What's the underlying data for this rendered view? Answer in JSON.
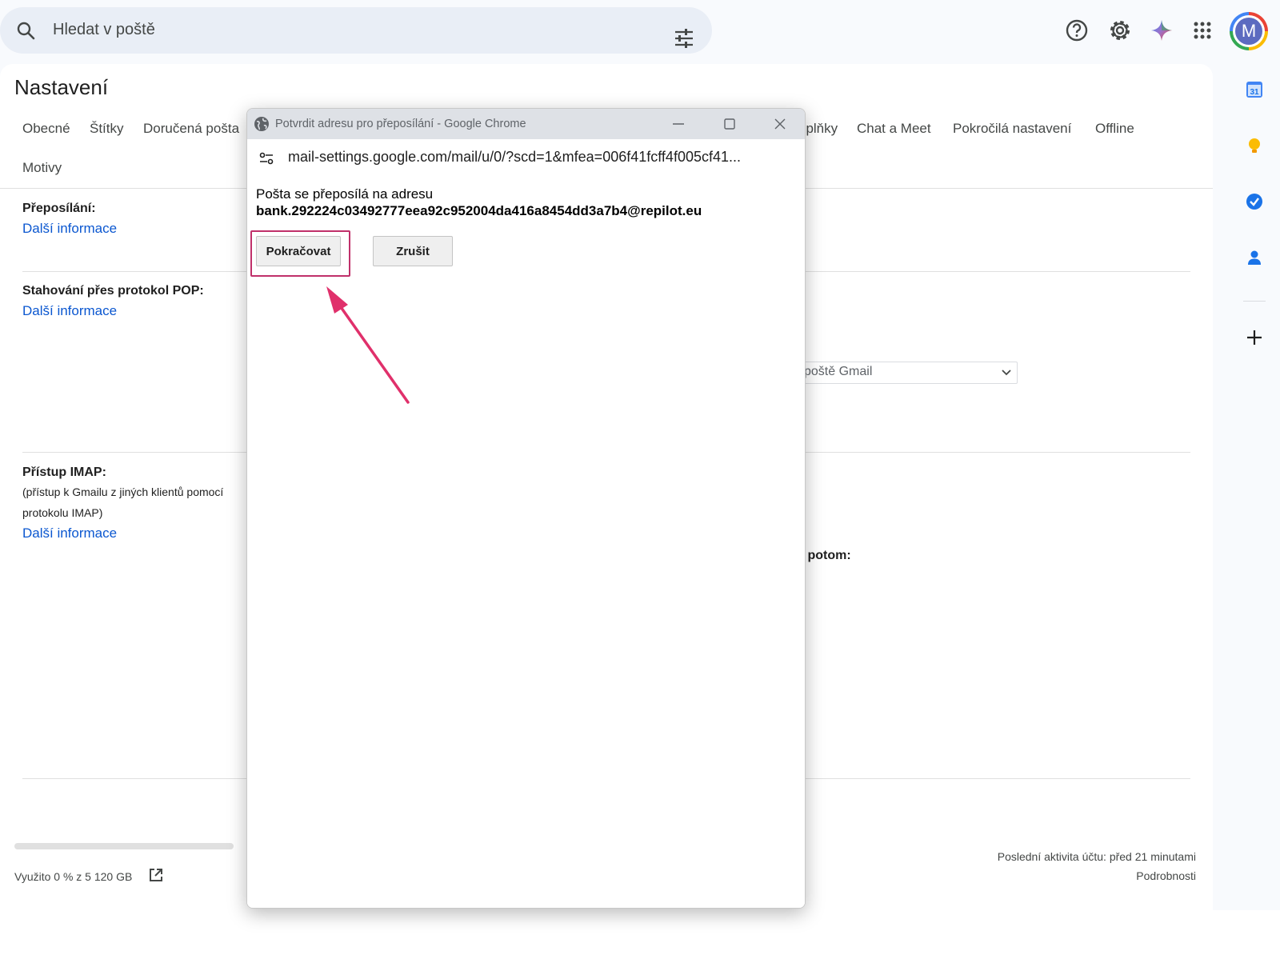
{
  "search": {
    "placeholder": "Hledat v poště"
  },
  "avatar": {
    "initial": "M"
  },
  "page_title": "Nastavení",
  "tabs": [
    "Obecné",
    "Štítky",
    "Doručená pošta",
    "oplňky",
    "Chat a Meet",
    "Pokročilá nastavení",
    "Offline",
    "Motivy"
  ],
  "sections": {
    "forwarding": {
      "label": "Přeposílání:",
      "link": "Další informace"
    },
    "pop": {
      "label": "Stahování přes protokol POP:",
      "link": "Další informace",
      "select_value": "poště Gmail"
    },
    "imap": {
      "label": "Přístup IMAP:",
      "desc1": "(přístup k Gmailu z jiných klientů pomocí",
      "desc2": "protokolu IMAP)",
      "link": "Další informace",
      "partial_text": "P, potom:"
    }
  },
  "side_panel": {
    "calendar_day": "31"
  },
  "footer": {
    "storage": "Využito 0 % z 5 120 GB",
    "storage_fraction": 0,
    "last_activity": "Poslední aktivita účtu: před 21 minutami",
    "details": "Podrobnosti"
  },
  "popup": {
    "title": "Potvrdit adresu pro přeposílání - Google Chrome",
    "url": "mail-settings.google.com/mail/u/0/?scd=1&mfea=006f41fcff4f005cf41...",
    "message": "Pošta se přeposílá na adresu",
    "address": "bank.292224c03492777eea92c952004da416a8454dd3a7b4@repilot.eu",
    "continue_label": "Pokračovat",
    "cancel_label": "Zrušit"
  },
  "colors": {
    "accent_link": "#0b57d0",
    "highlight": "#c0306a",
    "arrow": "#e0306b"
  }
}
